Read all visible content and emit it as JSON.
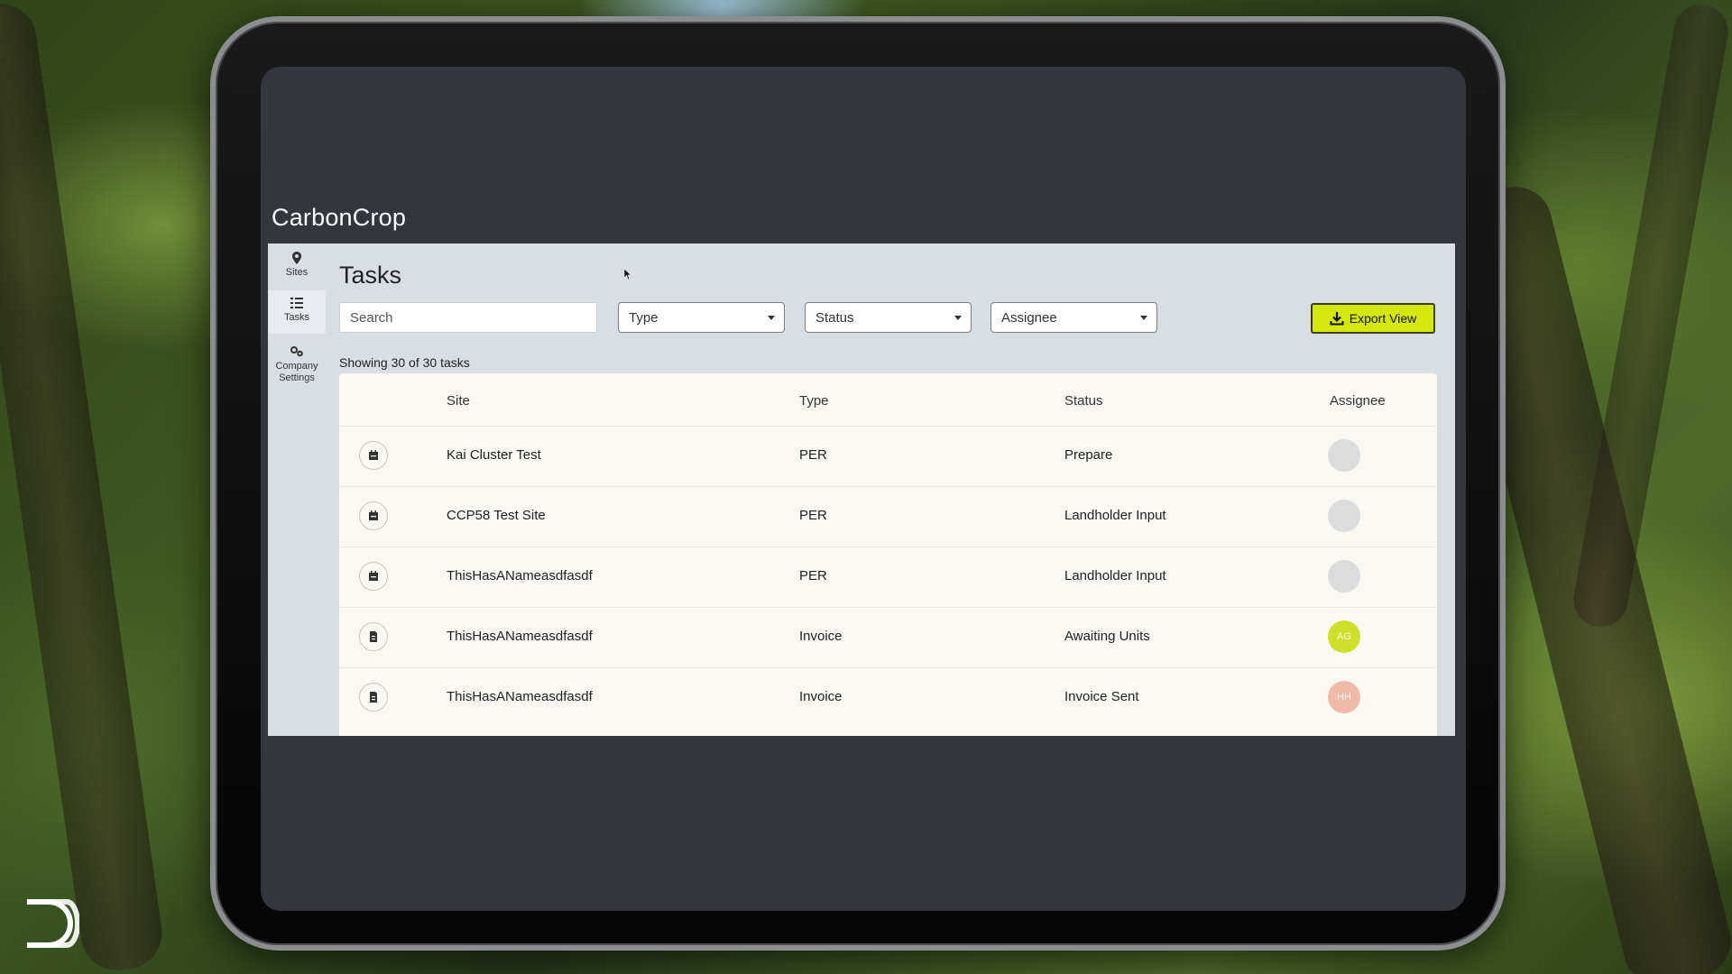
{
  "app": {
    "logo_text": "CarbonCrop",
    "page_title": "Tasks"
  },
  "sidebar": {
    "items": [
      {
        "label": "Sites",
        "icon": "map-pin-icon"
      },
      {
        "label": "Tasks",
        "icon": "task-list-icon",
        "active": true
      },
      {
        "label": "Company Settings",
        "icon": "settings-gears-icon"
      }
    ]
  },
  "filters": {
    "search_placeholder": "Search",
    "type_label": "Type",
    "status_label": "Status",
    "assignee_label": "Assignee",
    "export_label": "Export View"
  },
  "summary": {
    "showing_text": "Showing 30 of 30 tasks"
  },
  "table": {
    "headers": {
      "site": "Site",
      "type": "Type",
      "status": "Status",
      "assignee": "Assignee"
    },
    "rows": [
      {
        "icon": "calendar-icon",
        "site": "Kai Cluster Test",
        "type": "PER",
        "status": "Prepare",
        "assignee": "",
        "avatar_color": "#dcdcdc"
      },
      {
        "icon": "calendar-icon",
        "site": "CCP58 Test Site",
        "type": "PER",
        "status": "Landholder Input",
        "assignee": "",
        "avatar_color": "#dcdcdc"
      },
      {
        "icon": "calendar-icon",
        "site": "ThisHasANameasdfasdf",
        "type": "PER",
        "status": "Landholder Input",
        "assignee": "",
        "avatar_color": "#dcdcdc"
      },
      {
        "icon": "document-icon",
        "site": "ThisHasANameasdfasdf",
        "type": "Invoice",
        "status": "Awaiting Units",
        "assignee": "AG",
        "avatar_color": "#cfe02a"
      },
      {
        "icon": "document-icon",
        "site": "ThisHasANameasdfasdf",
        "type": "Invoice",
        "status": "Invoice Sent",
        "assignee": "HH",
        "avatar_color": "#f0b9a8"
      }
    ]
  },
  "colors": {
    "accent": "#d4e80d",
    "app_background": "#d9dde4",
    "table_background": "#faf8f3",
    "screen_background": "#33363d"
  }
}
